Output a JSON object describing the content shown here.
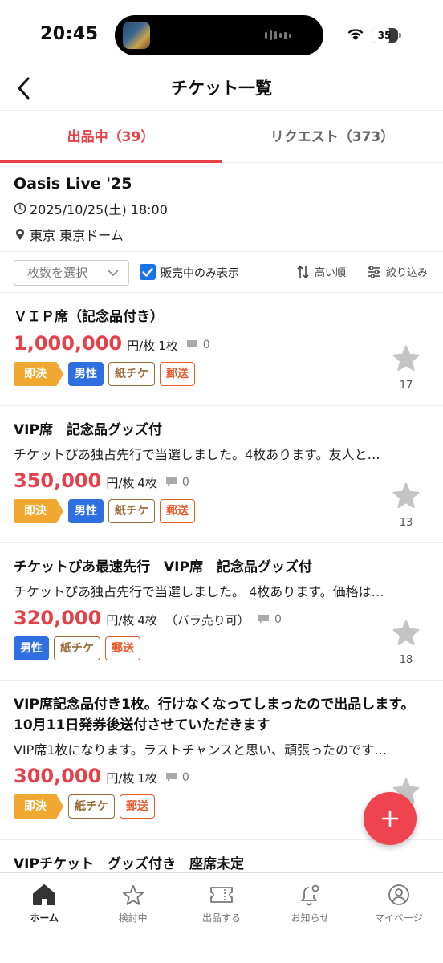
{
  "status": {
    "time": "20:45",
    "battery": "35"
  },
  "nav": {
    "title": "チケット一覧"
  },
  "tabs": [
    {
      "label": "出品中（39）",
      "active": true
    },
    {
      "label": "リクエスト（373）",
      "active": false
    }
  ],
  "event": {
    "name": "Oasis Live '25",
    "datetime": "2025/10/25(土) 18:00",
    "venue": "東京 東京ドーム"
  },
  "filters": {
    "count_select": "枚数を選択",
    "on_sale_only": "販売中のみ表示",
    "sort": "高い順",
    "filter": "絞り込み"
  },
  "listings": [
    {
      "title": "ＶＩＰ席（記念品付き）",
      "price": "1,000,000",
      "unit": "円/枚",
      "qty": "1枚",
      "comments": "0",
      "tags": [
        "即決",
        "男性",
        "紙チケ",
        "郵送"
      ],
      "favorites": "17"
    },
    {
      "title": "VIP席　記念品グッズ付",
      "desc": "チケットぴあ独占先行で当選しました。4枚あります。友人と…",
      "price": "350,000",
      "unit": "円/枚",
      "qty": "4枚",
      "comments": "0",
      "tags": [
        "即決",
        "男性",
        "紙チケ",
        "郵送"
      ],
      "favorites": "13"
    },
    {
      "title": "チケットぴあ最速先行　VIP席　記念品グッズ付",
      "desc": "チケットぴあ独占先行で当選しました。 4枚あります。価格は…",
      "price": "320,000",
      "unit": "円/枚",
      "qty": "4枚",
      "note": "（バラ売り可）",
      "comments": "0",
      "tags": [
        "男性",
        "紙チケ",
        "郵送"
      ],
      "favorites": "18"
    },
    {
      "title_line1": "VIP席記念品付き1枚。行けなくなってしまったので出品します。",
      "title_line2": "10月11日発券後送付させていただきます",
      "desc": "VIP席1枚になります。ラストチャンスと思い、頑張ったのです…",
      "price": "300,000",
      "unit": "円/枚",
      "qty": "1枚",
      "comments": "0",
      "tags": [
        "即決",
        "紙チケ",
        "郵送"
      ]
    },
    {
      "title": "VIPチケット　グッズ付き　座席未定"
    }
  ],
  "tabbar": [
    {
      "label": "ホーム",
      "icon": "home-icon",
      "active": true
    },
    {
      "label": "検討中",
      "icon": "star-outline-icon",
      "active": false
    },
    {
      "label": "出品する",
      "icon": "ticket-icon",
      "active": false
    },
    {
      "label": "お知らせ",
      "icon": "bell-icon",
      "active": false
    },
    {
      "label": "マイページ",
      "icon": "user-icon",
      "active": false
    }
  ],
  "colors": {
    "accent": "#e5414b",
    "instant": "#f0a830",
    "male": "#2f6fe0",
    "paper": "#9a6b3a",
    "mail": "#e85a2c"
  }
}
